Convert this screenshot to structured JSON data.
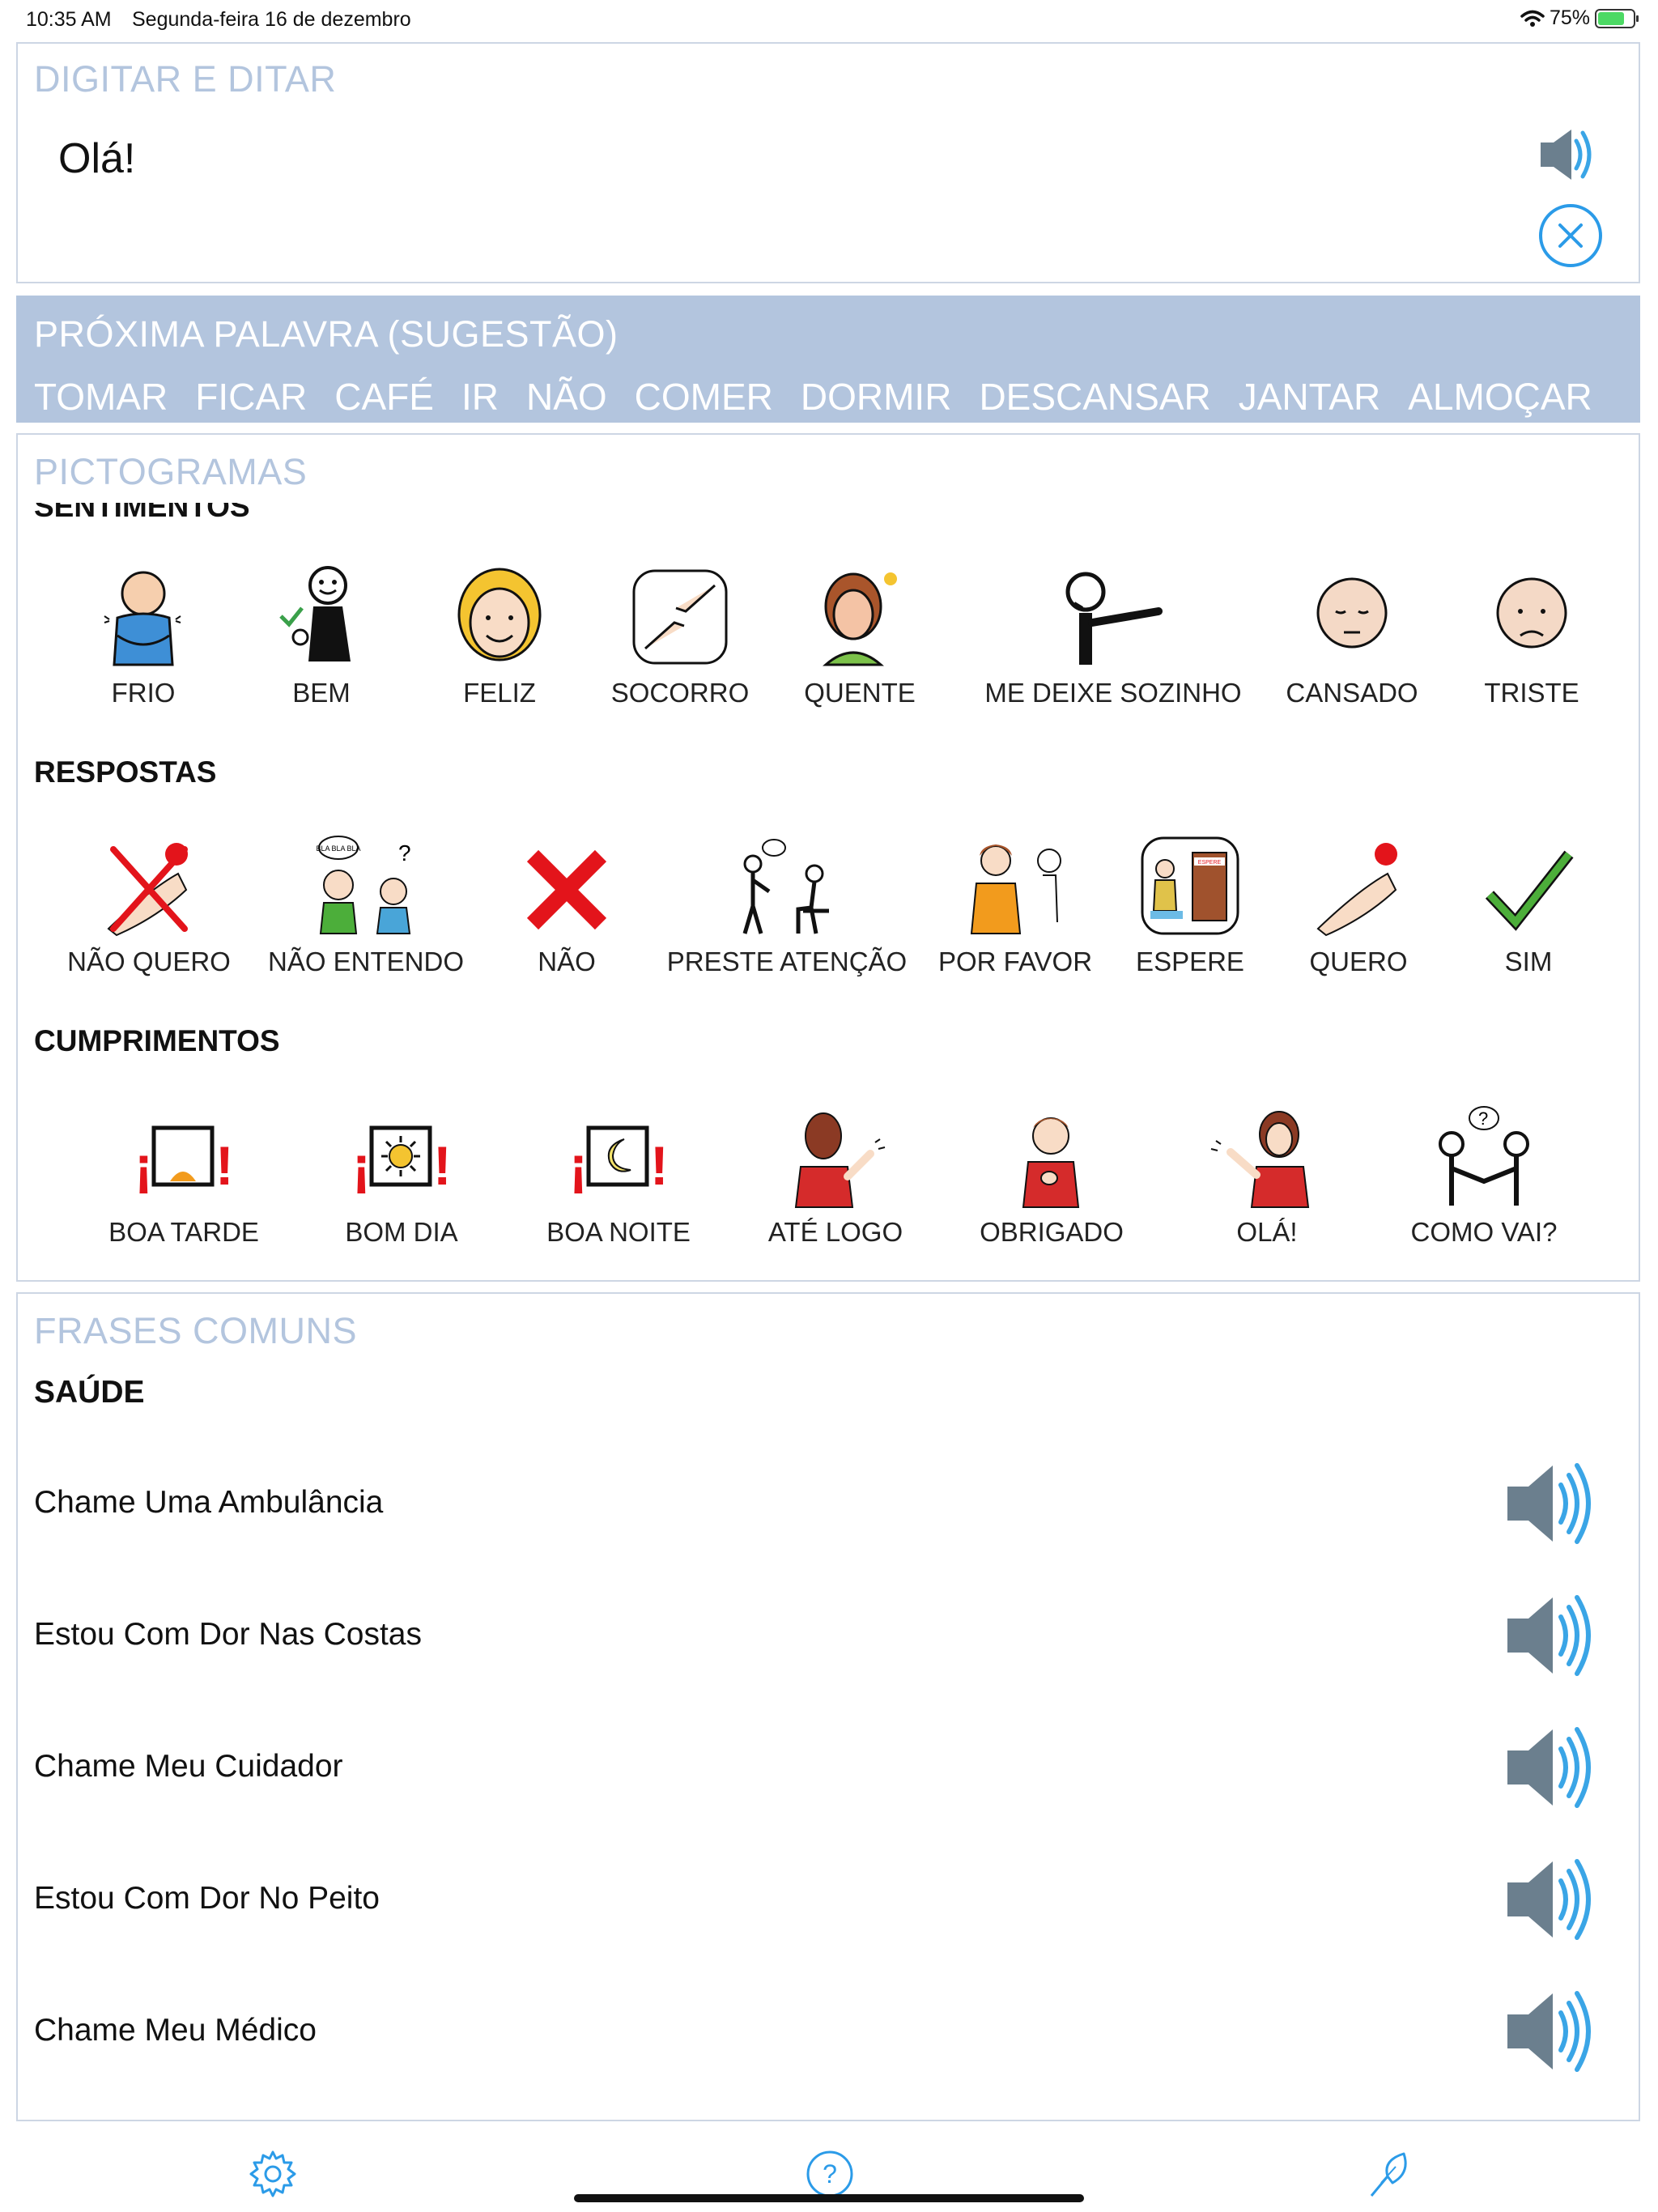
{
  "status_bar": {
    "time": "10:35 AM",
    "date": "Segunda-feira 16 de dezembro",
    "battery": "75%"
  },
  "typing": {
    "title": "DIGITAR E DITAR",
    "text": "Olá!"
  },
  "suggestions": {
    "title": "PRÓXIMA PALAVRA (SUGESTÃO)",
    "words": [
      "TOMAR",
      "FICAR",
      "CAFÉ",
      "IR",
      "NÃO",
      "COMER",
      "DORMIR",
      "DESCANSAR",
      "JANTAR",
      "ALMOÇAR"
    ]
  },
  "pictograms": {
    "title": "PICTOGRAMAS",
    "categories": [
      {
        "name": "SENTIMENTOS",
        "items": [
          "FRIO",
          "BEM",
          "FELIZ",
          "SOCORRO",
          "QUENTE",
          "ME DEIXE SOZINHO",
          "CANSADO",
          "TRISTE"
        ]
      },
      {
        "name": "RESPOSTAS",
        "items": [
          "NÃO QUERO",
          "NÃO ENTENDO",
          "NÃO",
          "PRESTE ATENÇÃO",
          "POR FAVOR",
          "ESPERE",
          "QUERO",
          "SIM"
        ]
      },
      {
        "name": "CUMPRIMENTOS",
        "items": [
          "BOA TARDE",
          "BOM DIA",
          "BOA NOITE",
          "ATÉ LOGO",
          "OBRIGADO",
          "OLÁ!",
          "COMO VAI?"
        ]
      }
    ],
    "bubble_text": "BLA BLA BLA",
    "door_sign": "ESPERE"
  },
  "phrases": {
    "title": "FRASES COMUNS",
    "category": "SAÚDE",
    "items": [
      "Chame Uma Ambulância",
      "Estou Com Dor Nas Costas",
      "Chame Meu Cuidador",
      "Estou Com Dor No Peito",
      "Chame Meu Médico"
    ]
  },
  "toolbar": {
    "icons": [
      "gear-icon",
      "help-icon",
      "feather-icon"
    ]
  },
  "colors": {
    "accent_blue": "#2b9be8",
    "section_title": "#b3c5de",
    "suggestion_bg": "#b3c5de",
    "panel_border": "#cdd6e4",
    "speaker_gray": "#6b7f8e",
    "speaker_wave": "#3aa5e6"
  }
}
